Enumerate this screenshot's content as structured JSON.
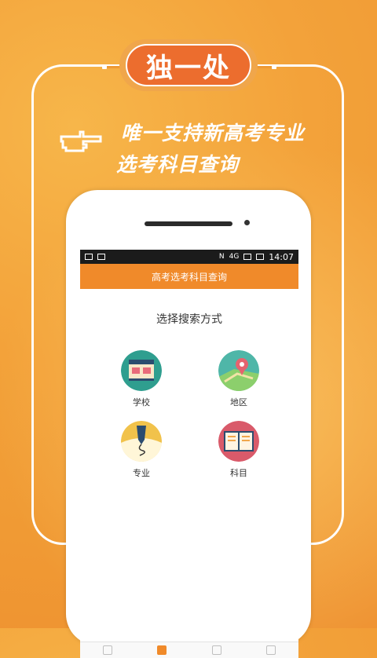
{
  "badge": {
    "text": "独一处"
  },
  "headline": {
    "line1": "唯一支持新高考专业",
    "line2": "选考科目查询"
  },
  "status_bar": {
    "network": "4G",
    "time": "14:07"
  },
  "app": {
    "title": "高考选考科目查询",
    "subtitle": "选择搜索方式"
  },
  "options": [
    {
      "label": "学校",
      "icon": "school-icon"
    },
    {
      "label": "地区",
      "icon": "map-pin-icon"
    },
    {
      "label": "专业",
      "icon": "pen-icon"
    },
    {
      "label": "科目",
      "icon": "book-icon"
    }
  ],
  "tabs": [
    {
      "icon": "home-tab-icon",
      "active": false
    },
    {
      "icon": "document-tab-icon",
      "active": true
    },
    {
      "icon": "news-tab-icon",
      "active": false
    },
    {
      "icon": "profile-tab-icon",
      "active": false
    }
  ],
  "colors": {
    "accent": "#f08a2a",
    "badge": "#ec6d2e",
    "background": "#f3a23a"
  }
}
